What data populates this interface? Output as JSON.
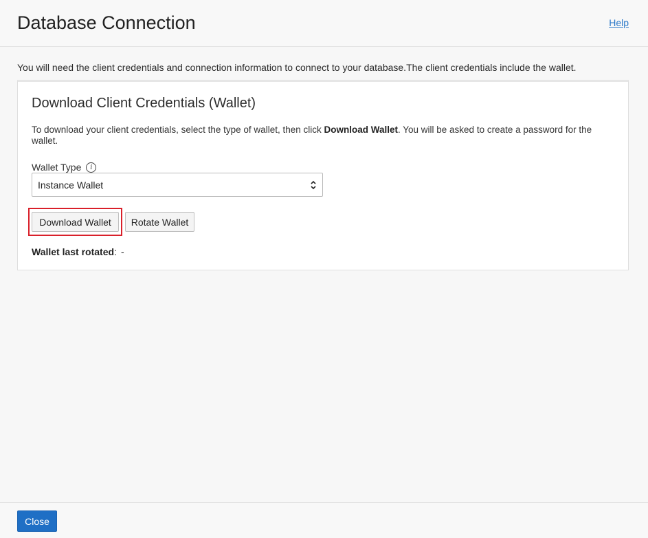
{
  "dialog": {
    "title": "Database Connection",
    "help_label": "Help",
    "intro_text": "You will need the client credentials and connection information to connect to your database.The client credentials include the wallet."
  },
  "panel": {
    "title": "Download Client Credentials (Wallet)",
    "desc_before": "To download your client credentials, select the type of wallet, then click ",
    "desc_bold": "Download Wallet",
    "desc_after": ". You will be asked to create a password for the wallet.",
    "wallet_type_label": "Wallet Type",
    "info_icon": "info-icon",
    "wallet_type_value": "Instance Wallet",
    "download_label": "Download Wallet",
    "rotate_label": "Rotate Wallet",
    "rotated_label": "Wallet last rotated",
    "rotated_colon": ":",
    "rotated_value": "-"
  },
  "footer": {
    "close_label": "Close"
  },
  "colors": {
    "accent": "#1f6fc5",
    "highlight": "#d9202a",
    "link": "#2a78c8"
  }
}
